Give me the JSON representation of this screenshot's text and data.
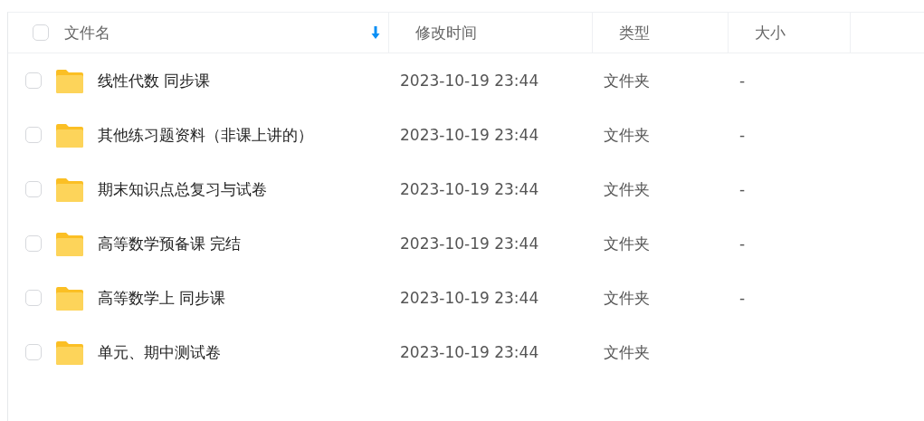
{
  "table": {
    "columns": [
      {
        "label": "文件名",
        "sorted": true
      },
      {
        "label": "修改时间",
        "sorted": false
      },
      {
        "label": "类型",
        "sorted": false
      },
      {
        "label": "大小",
        "sorted": false
      }
    ],
    "select_all": {
      "checked": false
    },
    "rows": [
      {
        "name": "线性代数 同步课",
        "modified": "2023-10-19 23:44",
        "type": "文件夹",
        "size": "-",
        "checked": false
      },
      {
        "name": "其他练习题资料（非课上讲的）",
        "modified": "2023-10-19 23:44",
        "type": "文件夹",
        "size": "-",
        "checked": false
      },
      {
        "name": "期末知识点总复习与试卷",
        "modified": "2023-10-19 23:44",
        "type": "文件夹",
        "size": "-",
        "checked": false
      },
      {
        "name": "高等数学预备课 完结",
        "modified": "2023-10-19 23:44",
        "type": "文件夹",
        "size": "-",
        "checked": false
      },
      {
        "name": "高等数学上 同步课",
        "modified": "2023-10-19 23:44",
        "type": "文件夹",
        "size": "-",
        "checked": false
      },
      {
        "name": "单元、期中测试卷",
        "modified": "2023-10-19 23:44",
        "type": "文件夹",
        "checked": false
      }
    ]
  }
}
